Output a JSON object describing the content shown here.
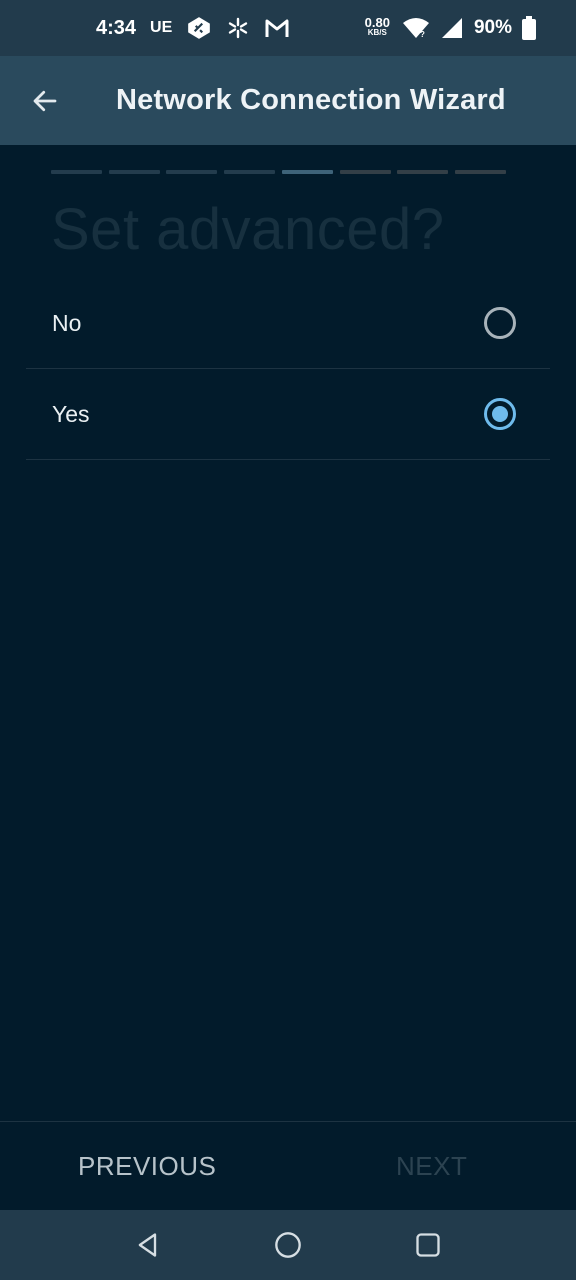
{
  "status_bar": {
    "time": "4:34",
    "carrier": "UE",
    "speed_value": "0.80",
    "speed_unit": "KB/S",
    "battery": "90%",
    "icons": [
      "tag-icon",
      "walmart-spark-icon",
      "gmail-icon",
      "wifi-icon",
      "signal-icon",
      "battery-icon"
    ]
  },
  "app_bar": {
    "title": "Network Connection Wizard",
    "back_icon": "arrow-left-icon"
  },
  "wizard": {
    "steps_total": 8,
    "current_step": 5,
    "question": "Set advanced?",
    "options": [
      {
        "label": "No",
        "selected": false
      },
      {
        "label": "Yes",
        "selected": true
      }
    ],
    "previous_label": "PREVIOUS",
    "next_label": "NEXT"
  },
  "system_nav": {
    "icons": [
      "back-triangle-icon",
      "home-circle-icon",
      "recents-square-icon"
    ]
  },
  "colors": {
    "background": "#021b2b",
    "app_bar": "#2a4a5d",
    "status_bar": "#223b4c",
    "accent": "#6fbbec"
  }
}
